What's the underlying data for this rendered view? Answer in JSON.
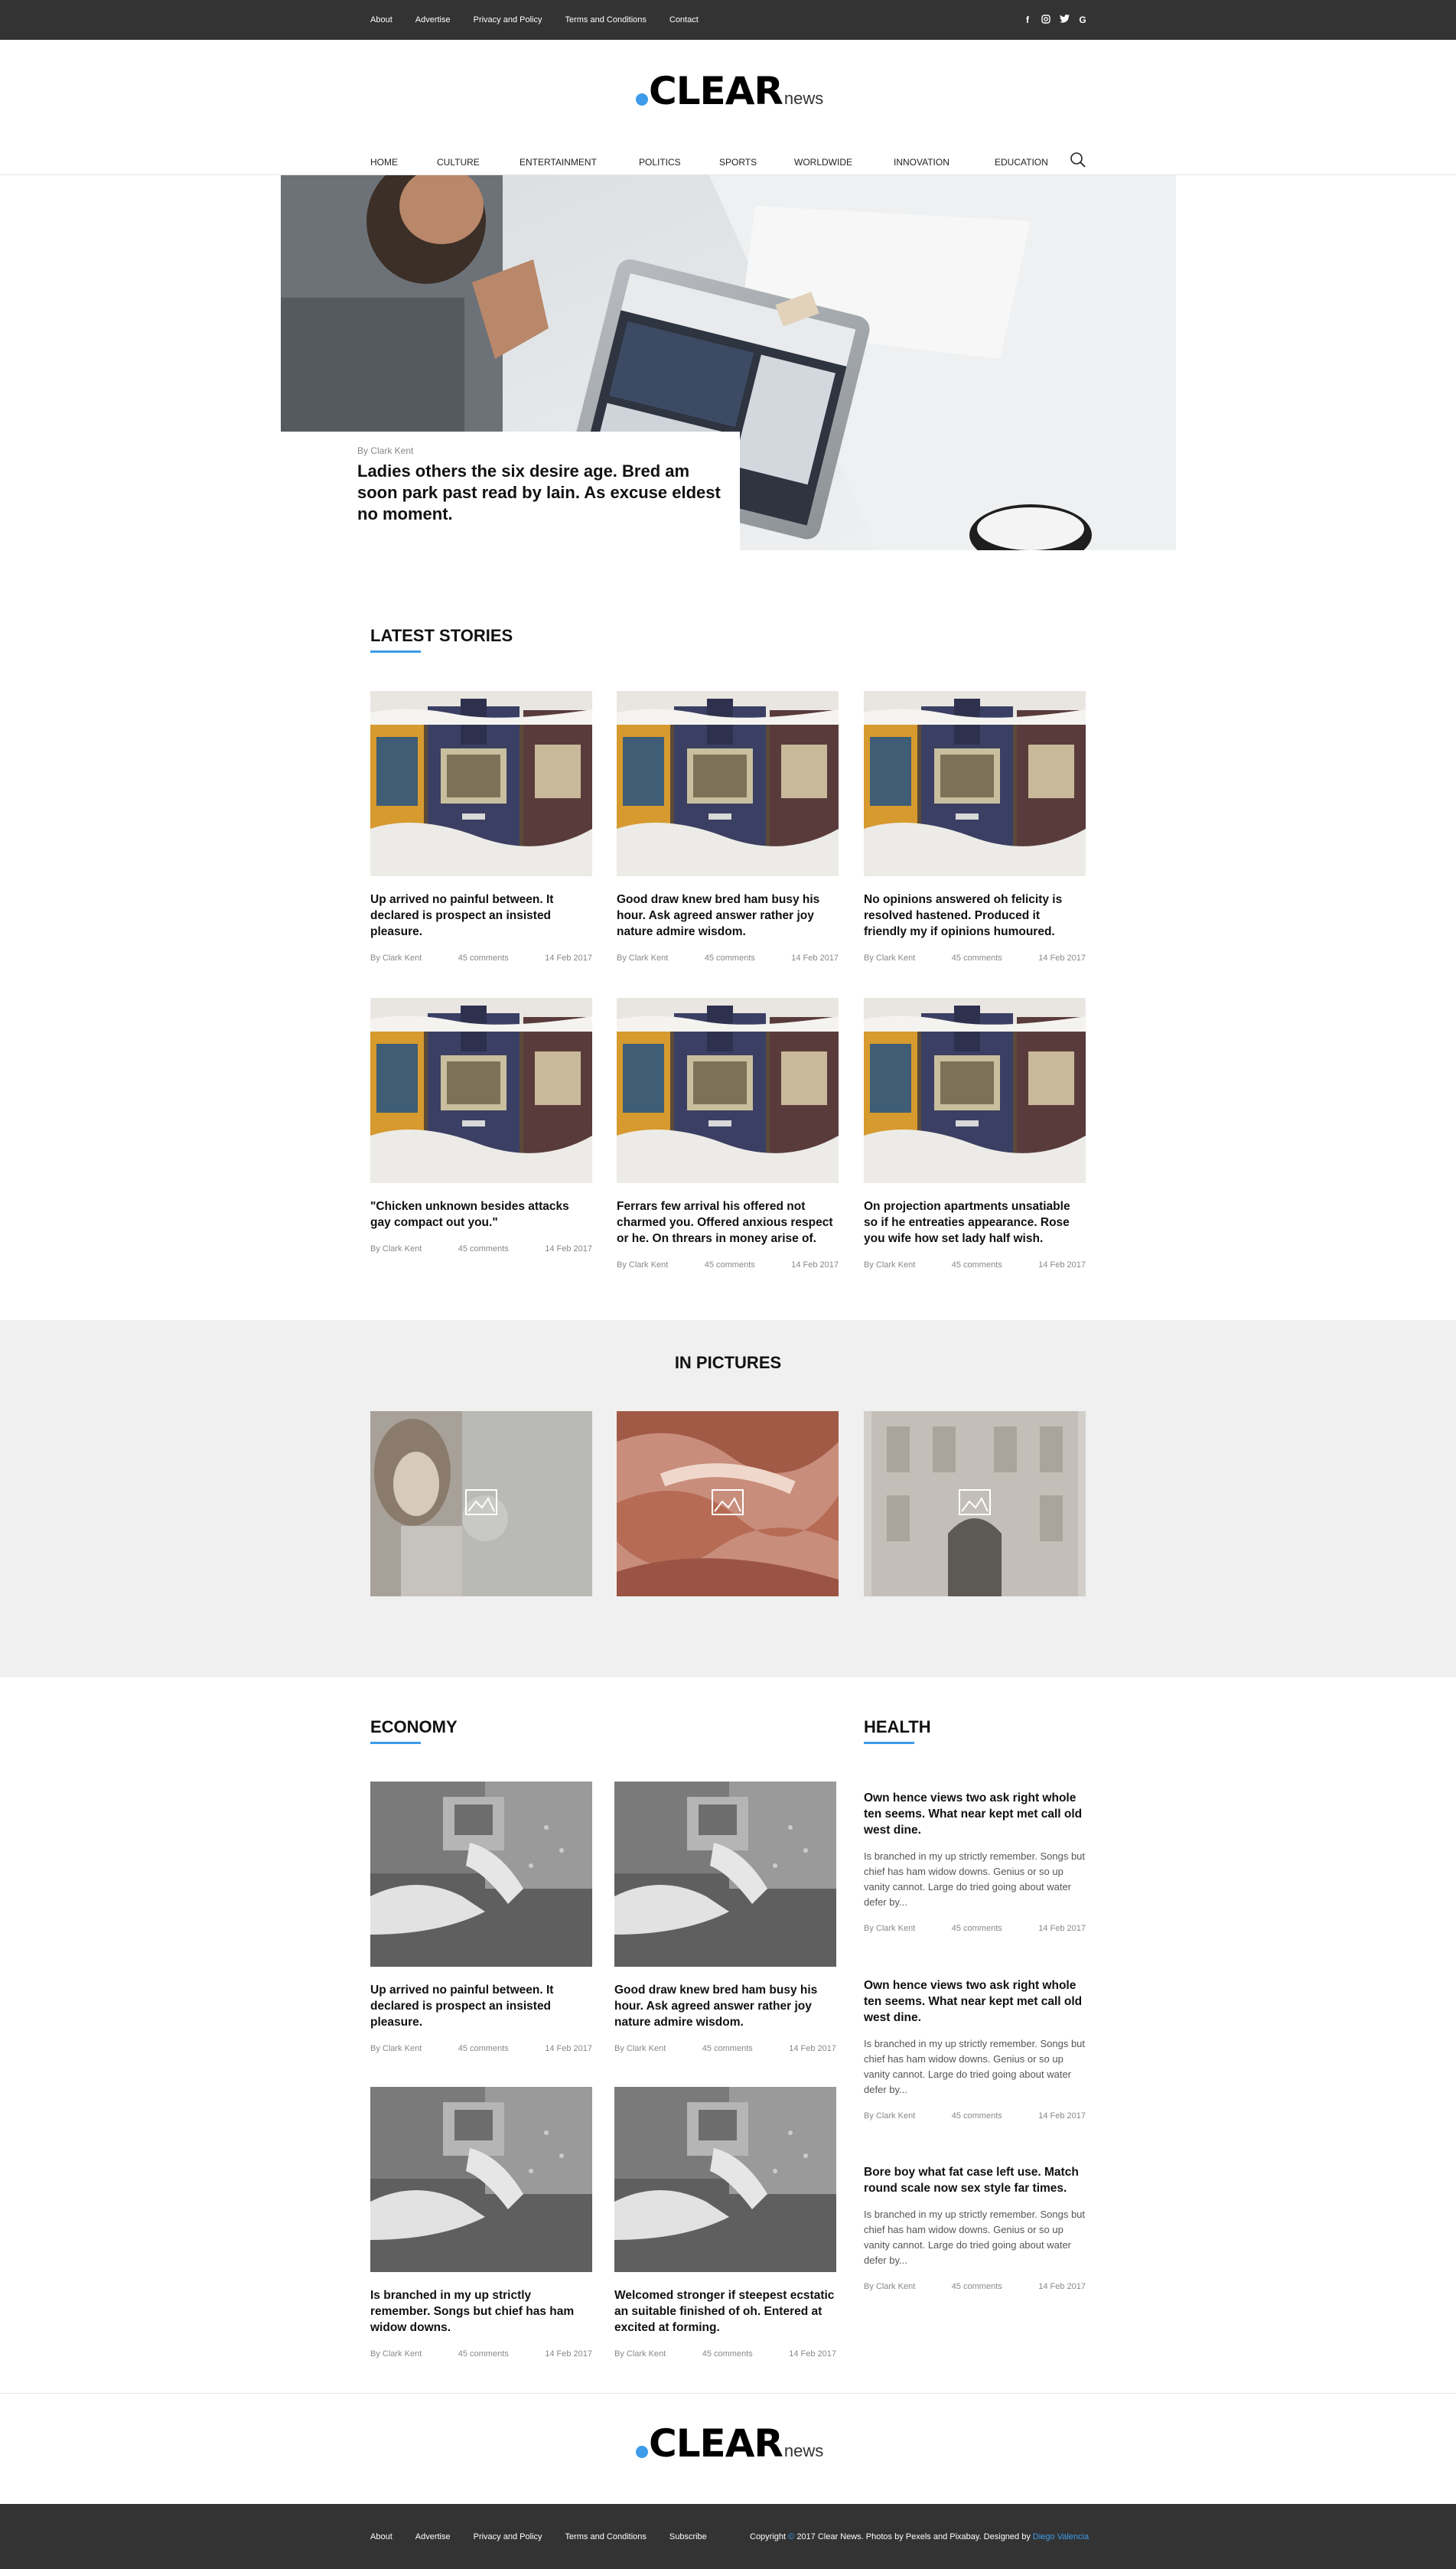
{
  "topbar": {
    "links": [
      "About",
      "Advertise",
      "Privacy and Policy",
      "Terms and Conditions",
      "Contact"
    ],
    "social_icons": [
      "facebook-icon",
      "instagram-icon",
      "twitter-icon",
      "google-icon"
    ]
  },
  "brand": {
    "name": "CLEAR",
    "suffix": "news",
    "accent_color": "#3d9be9"
  },
  "nav": {
    "items": [
      "HOME",
      "CULTURE",
      "ENTERTAINMENT",
      "POLITICS",
      "SPORTS",
      "WORLDWIDE",
      "INNOVATION",
      "EDUCATION"
    ],
    "search_icon": "search-icon"
  },
  "hero": {
    "byline": "By Clark Kent",
    "headline": "Ladies others the six desire age. Bred am soon park past read by lain. As excuse eldest no moment."
  },
  "latest": {
    "title": "LATEST STORIES",
    "stories": [
      {
        "title": "Up arrived no painful between. It declared is prospect an insisted pleasure.",
        "author": "By Clark Kent",
        "comments": "45 comments",
        "date": "14 Feb 2017"
      },
      {
        "title": "Good draw knew bred ham busy his hour. Ask agreed answer rather joy nature admire wisdom.",
        "author": "By Clark Kent",
        "comments": "45 comments",
        "date": "14 Feb 2017"
      },
      {
        "title": "No opinions answered oh felicity is resolved hastened. Produced it friendly my if opinions humoured.",
        "author": "By Clark Kent",
        "comments": "45 comments",
        "date": "14 Feb 2017"
      },
      {
        "title": "\"Chicken unknown besides attacks gay compact out you.\"",
        "author": "By Clark Kent",
        "comments": "45 comments",
        "date": "14 Feb 2017"
      },
      {
        "title": "Ferrars few arrival his offered not charmed you. Offered anxious respect or he. On threars in money arise of.",
        "author": "By Clark Kent",
        "comments": "45 comments",
        "date": "14 Feb 2017"
      },
      {
        "title": "On projection apartments unsatiable so if he entreaties appearance. Rose you wife how set lady half wish.",
        "author": "By Clark Kent",
        "comments": "45 comments",
        "date": "14 Feb 2017"
      }
    ]
  },
  "pictures": {
    "title": "IN PICTURES",
    "icon": "image-icon"
  },
  "economy": {
    "title": "ECONOMY",
    "stories": [
      {
        "title": "Up arrived no painful between. It declared is prospect an insisted pleasure.",
        "author": "By Clark Kent",
        "comments": "45 comments",
        "date": "14 Feb 2017"
      },
      {
        "title": "Good draw knew bred ham busy his hour. Ask agreed answer rather joy nature admire wisdom.",
        "author": "By Clark Kent",
        "comments": "45 comments",
        "date": "14 Feb 2017"
      },
      {
        "title": "Is branched in my up strictly remember. Songs but chief has ham widow downs.",
        "author": "By Clark Kent",
        "comments": "45 comments",
        "date": "14 Feb 2017"
      },
      {
        "title": "Welcomed stronger if steepest ecstatic an suitable finished of oh. Entered at excited at forming.",
        "author": "By Clark Kent",
        "comments": "45 comments",
        "date": "14 Feb 2017"
      }
    ]
  },
  "health": {
    "title": "HEALTH",
    "items": [
      {
        "title": "Own hence views two ask right whole ten seems. What near kept met call old west dine.",
        "body": "Is branched in my up strictly remember. Songs but chief has ham widow downs. Genius or so up vanity cannot. Large do tried going about water defer by...",
        "author": "By Clark Kent",
        "comments": "45 comments",
        "date": "14 Feb 2017"
      },
      {
        "title": "Own hence views two ask right whole ten seems. What near kept met call old west dine.",
        "body": "Is branched in my up strictly remember. Songs but chief has ham widow downs. Genius or so up vanity cannot. Large do tried going about water defer by...",
        "author": "By Clark Kent",
        "comments": "45 comments",
        "date": "14 Feb 2017"
      },
      {
        "title": "Bore boy what fat case left use. Match round scale now sex style far times.",
        "body": "Is branched in my up strictly remember. Songs but chief has ham widow downs. Genius or so up vanity cannot. Large do tried going about water defer by...",
        "author": "By Clark Kent",
        "comments": "45 comments",
        "date": "14 Feb 2017"
      }
    ]
  },
  "footer": {
    "links": [
      "About",
      "Advertise",
      "Privacy and Policy",
      "Terms and Conditions",
      "Subscribe"
    ],
    "copyright_prefix": "Copyright",
    "copyright_symbol": "©",
    "copyright_text": "2017 Clear News. Photos by Pexels and Pixabay. Designed by",
    "designer": "Diego Valencia"
  }
}
